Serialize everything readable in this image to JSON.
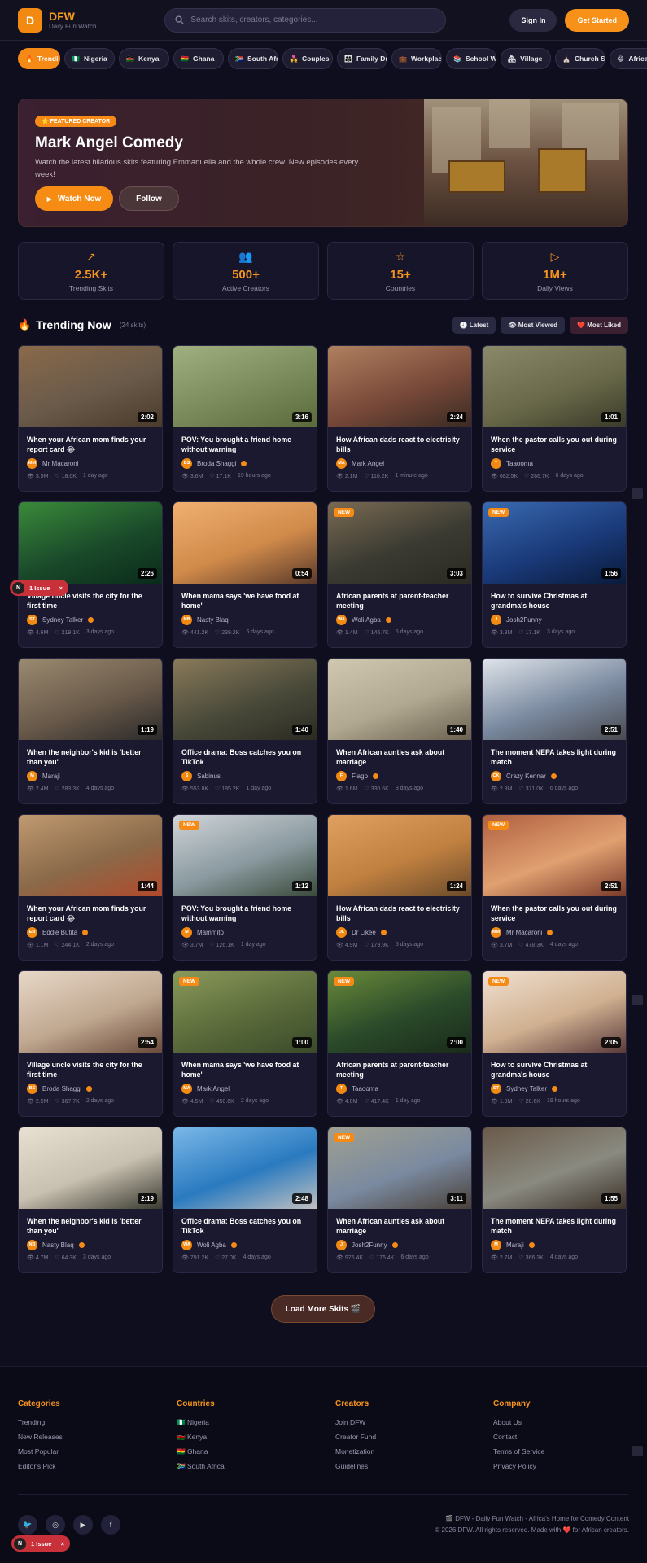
{
  "brand": {
    "initial": "D",
    "name": "DFW",
    "tagline": "Daily Fun Watch"
  },
  "search": {
    "placeholder": "Search skits, creators, categories..."
  },
  "header": {
    "signin": "Sign In",
    "get_started": "Get Started"
  },
  "categories": [
    {
      "flag": "🔥",
      "label": "Trending"
    },
    {
      "flag": "🇳🇬",
      "label": "Nigeria"
    },
    {
      "flag": "🇰🇪",
      "label": "Kenya"
    },
    {
      "flag": "🇬🇭",
      "label": "Ghana"
    },
    {
      "flag": "🇿🇦",
      "label": "South Africa"
    },
    {
      "flag": "💑",
      "label": "Couples"
    },
    {
      "flag": "👨‍👩‍👧",
      "label": "Family Drama"
    },
    {
      "flag": "💼",
      "label": "Workplace"
    },
    {
      "flag": "📚",
      "label": "School Wahala"
    },
    {
      "flag": "🏘",
      "label": "Village"
    },
    {
      "flag": "⛪",
      "label": "Church Skits"
    },
    {
      "flag": "😂",
      "label": "African Parents"
    }
  ],
  "hero": {
    "badge": "⭐ FEATURED CREATOR",
    "title": "Mark Angel Comedy",
    "description": "Watch the latest hilarious skits featuring Emmanuella and the whole crew. New episodes every week!",
    "watch": "Watch Now",
    "follow": "Follow"
  },
  "stats": [
    {
      "icon": "↗",
      "value": "2.5K+",
      "label": "Trending Skits"
    },
    {
      "icon": "👥",
      "value": "500+",
      "label": "Active Creators"
    },
    {
      "icon": "☆",
      "value": "15+",
      "label": "Countries"
    },
    {
      "icon": "▷",
      "value": "1M+",
      "label": "Daily Views"
    }
  ],
  "trending": {
    "icon": "🔥",
    "title": "Trending Now",
    "count": "(24 skits)",
    "sorts": [
      "🕘 Latest",
      "👁 Most Viewed",
      "❤️ Most Liked"
    ]
  },
  "skits": [
    {
      "title": "When your African mom finds your report card 😂",
      "creator": "Mr Macaroni",
      "initials": "MM",
      "verified": false,
      "views": "3.5M",
      "likes": "18.0K",
      "time": "1 day ago",
      "duration": "2:02",
      "new": false,
      "colors": [
        "#6a5a4a",
        "#8a6a4a",
        "#4a3a2a"
      ]
    },
    {
      "title": "POV: You brought a friend home without warning",
      "creator": "Broda Shaggi",
      "initials": "BS",
      "verified": true,
      "views": "3.6M",
      "likes": "17.1K",
      "time": "19 hours ago",
      "duration": "3:16",
      "new": false,
      "colors": [
        "#7a8a5a",
        "#a0b080",
        "#5a6a3a"
      ]
    },
    {
      "title": "How African dads react to electricity bills",
      "creator": "Mark Angel",
      "initials": "MA",
      "verified": false,
      "views": "2.1M",
      "likes": "110.2K",
      "time": "1 minute ago",
      "duration": "2:24",
      "new": false,
      "colors": [
        "#7a4a3a",
        "#b08060",
        "#3a2a22"
      ]
    },
    {
      "title": "When the pastor calls you out during service",
      "creator": "Taaooma",
      "initials": "T",
      "verified": false,
      "views": "682.5K",
      "likes": "286.7K",
      "time": "6 days ago",
      "duration": "1:01",
      "new": false,
      "colors": [
        "#6a6a4a",
        "#8a8a6a",
        "#3a3a2a"
      ]
    },
    {
      "title": "Village uncle visits the city for the first time",
      "creator": "Sydney Talker",
      "initials": "ST",
      "verified": true,
      "views": "4.6M",
      "likes": "219.1K",
      "time": "3 days ago",
      "duration": "2:26",
      "new": false,
      "colors": [
        "#1a4a2a",
        "#3a8a3a",
        "#0a2a1a"
      ]
    },
    {
      "title": "When mama says 'we have food at home'",
      "creator": "Nasty Blaq",
      "initials": "NB",
      "verified": false,
      "views": "441.2K",
      "likes": "239.2K",
      "time": "6 days ago",
      "duration": "0:54",
      "new": false,
      "colors": [
        "#d08a4a",
        "#f0b070",
        "#5a3a2a"
      ]
    },
    {
      "title": "African parents at parent-teacher meeting",
      "creator": "Woli Agba",
      "initials": "WA",
      "verified": true,
      "views": "1.4M",
      "likes": "146.7K",
      "time": "5 days ago",
      "duration": "3:03",
      "new": true,
      "colors": [
        "#3a3a32",
        "#7a6a52",
        "#2a2a22"
      ]
    },
    {
      "title": "How to survive Christmas at grandma's house",
      "creator": "Josh2Funny",
      "initials": "J",
      "verified": false,
      "views": "3.8M",
      "likes": "17.1K",
      "time": "3 days ago",
      "duration": "1:56",
      "new": true,
      "colors": [
        "#1a3a7a",
        "#3a6ab0",
        "#0a1a3a"
      ]
    },
    {
      "title": "When the neighbor's kid is 'better than you'",
      "creator": "Maraji",
      "initials": "M",
      "verified": false,
      "views": "2.4M",
      "likes": "283.3K",
      "time": "4 days ago",
      "duration": "1:19",
      "new": false,
      "colors": [
        "#6a5a4a",
        "#9a8a70",
        "#2a2a2a"
      ]
    },
    {
      "title": "Office drama: Boss catches you on TikTok",
      "creator": "Sabinus",
      "initials": "S",
      "verified": false,
      "views": "553.8K",
      "likes": "185.2K",
      "time": "1 day ago",
      "duration": "1:40",
      "new": false,
      "colors": [
        "#4a4a3a",
        "#8a7a5a",
        "#2a2a22"
      ]
    },
    {
      "title": "When African aunties ask about marriage",
      "creator": "Fiago",
      "initials": "F",
      "verified": true,
      "views": "1.6M",
      "likes": "330.6K",
      "time": "3 days ago",
      "duration": "1:40",
      "new": false,
      "colors": [
        "#b0a890",
        "#d0c8b0",
        "#6a6050"
      ]
    },
    {
      "title": "The moment NEPA takes light during match",
      "creator": "Crazy Kennar",
      "initials": "CK",
      "verified": true,
      "views": "2.9M",
      "likes": "371.0K",
      "time": "6 days ago",
      "duration": "2:51",
      "new": false,
      "colors": [
        "#7a8aa0",
        "#e0e4ea",
        "#4a4a50"
      ]
    },
    {
      "title": "When your African mom finds your report card 😂",
      "creator": "Eddie Butita",
      "initials": "EB",
      "verified": true,
      "views": "1.1M",
      "likes": "244.1K",
      "time": "2 days ago",
      "duration": "1:44",
      "new": false,
      "colors": [
        "#8a6a4a",
        "#c09a70",
        "#b04a2a"
      ]
    },
    {
      "title": "POV: You brought a friend home without warning",
      "creator": "Mammito",
      "initials": "M",
      "verified": false,
      "views": "3.7M",
      "likes": "126.1K",
      "time": "1 day ago",
      "duration": "1:12",
      "new": true,
      "colors": [
        "#8a9aa0",
        "#d0d4d8",
        "#3a4a3a"
      ]
    },
    {
      "title": "How African dads react to electricity bills",
      "creator": "Dr Likee",
      "initials": "DL",
      "verified": true,
      "views": "4.9M",
      "likes": "179.9K",
      "time": "5 days ago",
      "duration": "1:24",
      "new": false,
      "colors": [
        "#c08040",
        "#e0a060",
        "#6a4a2a"
      ]
    },
    {
      "title": "When the pastor calls you out during service",
      "creator": "Mr Macaroni",
      "initials": "MM",
      "verified": true,
      "views": "3.7M",
      "likes": "478.3K",
      "time": "4 days ago",
      "duration": "2:51",
      "new": true,
      "colors": [
        "#e0a070",
        "#b06040",
        "#7a3a2a"
      ]
    },
    {
      "title": "Village uncle visits the city for the first time",
      "creator": "Broda Shaggi",
      "initials": "BS",
      "verified": true,
      "views": "2.5M",
      "likes": "367.7K",
      "time": "2 days ago",
      "duration": "2:54",
      "new": false,
      "colors": [
        "#c0a890",
        "#e8d8c8",
        "#6a4a3a"
      ]
    },
    {
      "title": "When mama says 'we have food at home'",
      "creator": "Mark Angel",
      "initials": "MA",
      "verified": false,
      "views": "4.5M",
      "likes": "450.6K",
      "time": "2 days ago",
      "duration": "1:00",
      "new": true,
      "colors": [
        "#5a6a3a",
        "#8a9a5a",
        "#3a4a2a"
      ]
    },
    {
      "title": "African parents at parent-teacher meeting",
      "creator": "Taaooma",
      "initials": "T",
      "verified": false,
      "views": "4.0M",
      "likes": "417.4K",
      "time": "1 day ago",
      "duration": "2:00",
      "new": true,
      "colors": [
        "#2a4a2a",
        "#6a8a3a",
        "#1a2a1a"
      ]
    },
    {
      "title": "How to survive Christmas at grandma's house",
      "creator": "Sydney Talker",
      "initials": "ST",
      "verified": true,
      "views": "1.9M",
      "likes": "20.6K",
      "time": "19 hours ago",
      "duration": "2:05",
      "new": true,
      "colors": [
        "#d0b090",
        "#f0e0d0",
        "#5a3a3a"
      ]
    },
    {
      "title": "When the neighbor's kid is 'better than you'",
      "creator": "Nasty Blaq",
      "initials": "NB",
      "verified": true,
      "views": "4.7M",
      "likes": "64.3K",
      "time": "3 days ago",
      "duration": "2:19",
      "new": false,
      "colors": [
        "#c8c0b0",
        "#e8e0d0",
        "#3a3a30"
      ]
    },
    {
      "title": "Office drama: Boss catches you on TikTok",
      "creator": "Woli Agba",
      "initials": "WA",
      "verified": true,
      "views": "791.2K",
      "likes": "27.0K",
      "time": "4 days ago",
      "duration": "2:48",
      "new": false,
      "colors": [
        "#2a7ac0",
        "#7ab8e8",
        "#c0c0c0"
      ]
    },
    {
      "title": "When African aunties ask about marriage",
      "creator": "Josh2Funny",
      "initials": "J",
      "verified": true,
      "views": "976.4K",
      "likes": "176.4K",
      "time": "6 days ago",
      "duration": "3:11",
      "new": true,
      "colors": [
        "#7a8aa0",
        "#a0a090",
        "#4a4038"
      ]
    },
    {
      "title": "The moment NEPA takes light during match",
      "creator": "Maraji",
      "initials": "M",
      "verified": true,
      "views": "2.7M",
      "likes": "366.3K",
      "time": "4 days ago",
      "duration": "1:55",
      "new": false,
      "colors": [
        "#8a8a80",
        "#6a5a4a",
        "#3a3028"
      ]
    }
  ],
  "load_more": "Load More Skits 🎬",
  "footer": {
    "columns": [
      {
        "title": "Categories",
        "links": [
          "Trending",
          "New Releases",
          "Most Popular",
          "Editor's Pick"
        ]
      },
      {
        "title": "Countries",
        "links": [
          "🇳🇬 Nigeria",
          "🇰🇪 Kenya",
          "🇬🇭 Ghana",
          "🇿🇦 South Africa"
        ]
      },
      {
        "title": "Creators",
        "links": [
          "Join DFW",
          "Creator Fund",
          "Monetization",
          "Guidelines"
        ]
      },
      {
        "title": "Company",
        "links": [
          "About Us",
          "Contact",
          "Terms of Service",
          "Privacy Policy"
        ]
      }
    ],
    "socials": [
      "twitter-icon",
      "instagram-icon",
      "youtube-icon",
      "facebook-icon"
    ],
    "tagline": "🎬 DFW - Daily Fun Watch - Africa's Home for Comedy Content",
    "copyright": "© 2026 DFW. All rights reserved. Made with ❤️ for African creators."
  },
  "issue_badge": {
    "letter": "N",
    "label": "1 Issue",
    "close": "×"
  }
}
